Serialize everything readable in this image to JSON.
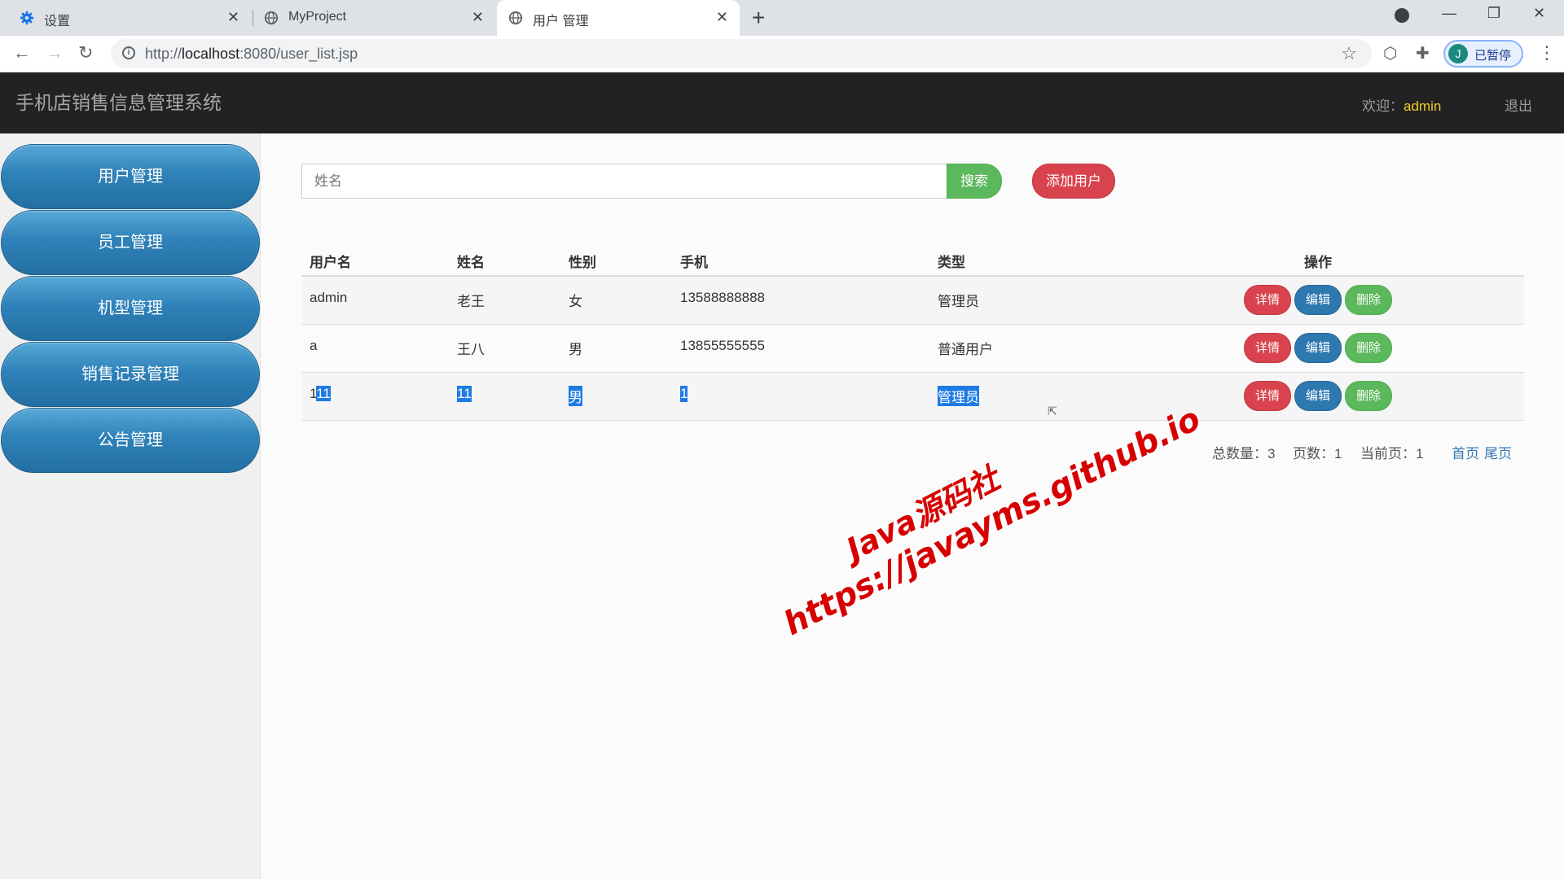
{
  "browser": {
    "tabs": [
      {
        "title": "设置",
        "icon": "gear-icon"
      },
      {
        "title": "MyProject",
        "icon": "globe-icon"
      },
      {
        "title": "用户 管理",
        "icon": "globe-icon",
        "active": true
      }
    ],
    "url_prefix": "http://",
    "url_host": "localhost",
    "url_rest": ":8080/user_list.jsp",
    "profile_initial": "J",
    "profile_label": "已暂停"
  },
  "header": {
    "brand": "手机店销售信息管理系统",
    "welcome_label": "欢迎：",
    "username": "admin",
    "logout": "退出",
    "background": "#222222",
    "username_color": "#f4ce29"
  },
  "sidebar": {
    "items": [
      {
        "label": "用户管理"
      },
      {
        "label": "员工管理"
      },
      {
        "label": "机型管理"
      },
      {
        "label": "销售记录管理"
      },
      {
        "label": "公告管理"
      }
    ],
    "item_color": "#2f82b9"
  },
  "search": {
    "placeholder": "姓名",
    "button": "搜索",
    "add_button": "添加用户"
  },
  "table": {
    "columns": [
      "用户名",
      "姓名",
      "性别",
      "手机",
      "类型",
      "操作"
    ],
    "rows": [
      {
        "username": "admin",
        "name": "老王",
        "gender": "女",
        "phone": "13588888888",
        "type": "管理员"
      },
      {
        "username": "a",
        "name": "王八",
        "gender": "男",
        "phone": "13855555555",
        "type": "普通用户"
      },
      {
        "username_plain": "1",
        "username_sel": "11",
        "name": "11",
        "gender": "男",
        "phone": "1",
        "type": "管理员"
      }
    ],
    "actions": {
      "detail": "详情",
      "edit": "编辑",
      "delete": "删除"
    }
  },
  "pager": {
    "total_label": "总数量：3",
    "pages_label": "页数：1",
    "current_label": "当前页：1",
    "first": "首页",
    "last": "尾页"
  },
  "watermark": {
    "line1": "Java源码社",
    "line2": "https://javayms.github.io"
  },
  "colors": {
    "success": "#5cb85c",
    "danger": "#d9434e",
    "primary": "#2e78b0",
    "selection": "#1e7be6"
  }
}
